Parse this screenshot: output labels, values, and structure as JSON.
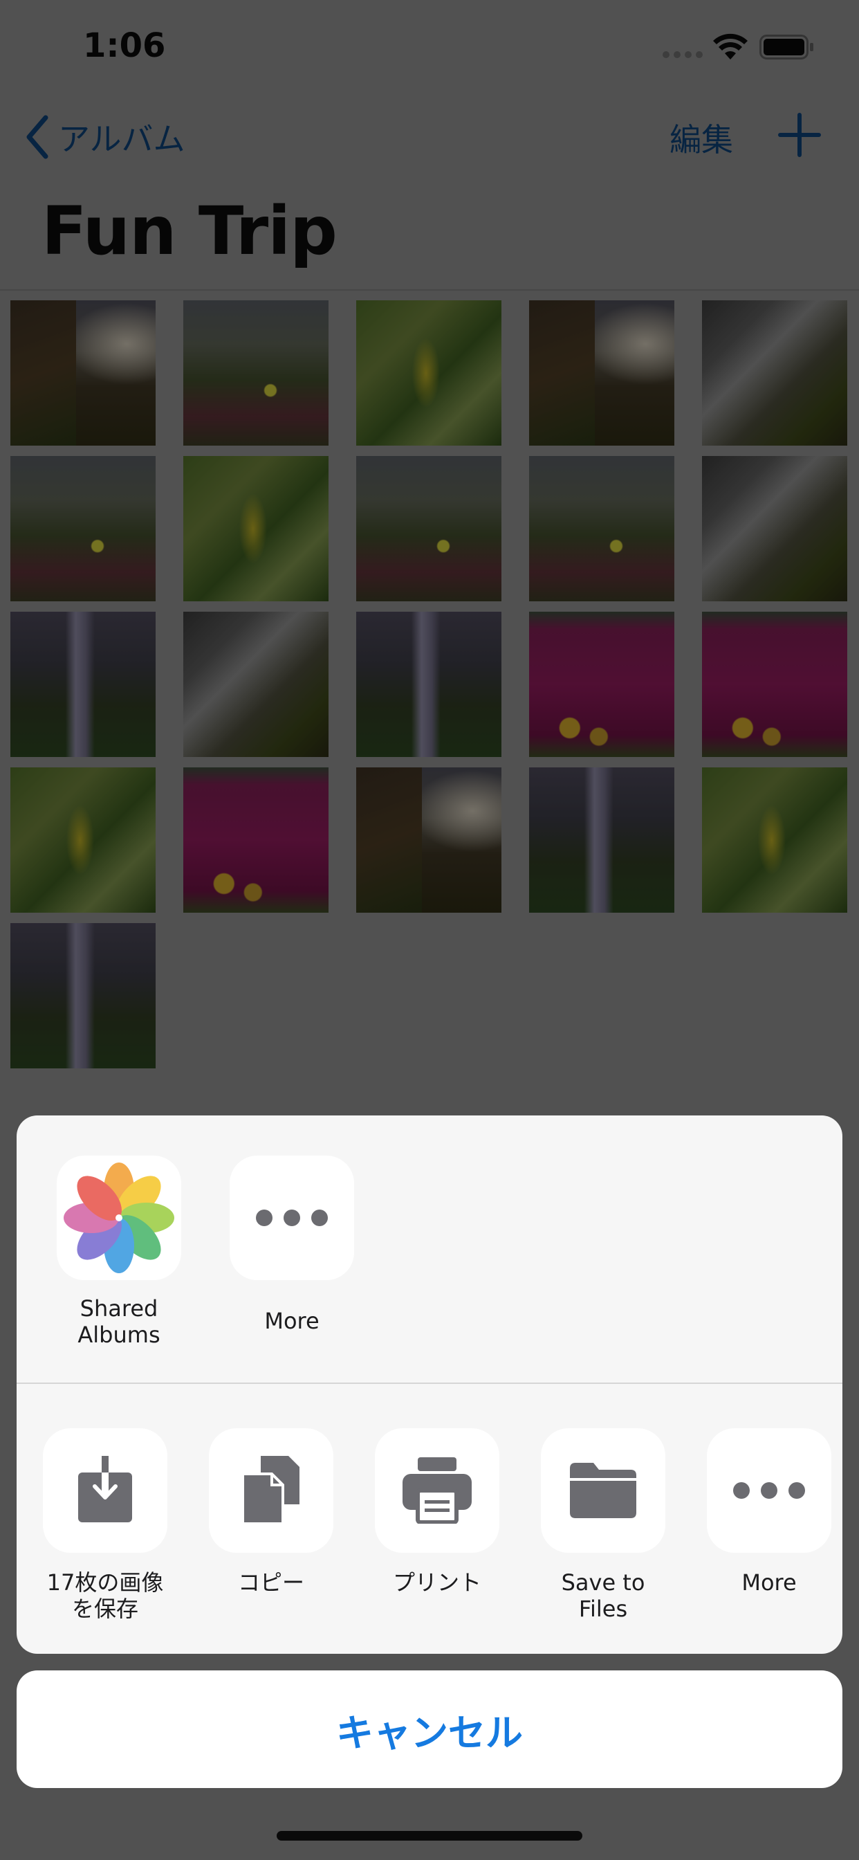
{
  "status_bar": {
    "time": "1:06"
  },
  "nav": {
    "back_label": "アルバム",
    "edit_label": "編集",
    "title": "Fun Trip"
  },
  "photos": [
    "waterfall-cliff",
    "grass-flower",
    "leaves",
    "waterfall-cliff",
    "rapids",
    "grass-flower",
    "leaves",
    "grass-flower",
    "grass-flower",
    "rapids",
    "tall-fall",
    "rapids",
    "tall-fall",
    "pink",
    "pink",
    "leaves",
    "pink",
    "waterfall-cliff",
    "tall-fall",
    "leaves",
    "tall-fall"
  ],
  "share_sheet": {
    "apps": [
      {
        "label": "Shared\nAlbums",
        "icon": "photos-icon"
      },
      {
        "label": "More",
        "icon": "more-icon"
      }
    ],
    "actions": [
      {
        "label": "17枚の画像\nを保存",
        "icon": "save-image-icon"
      },
      {
        "label": "コピー",
        "icon": "copy-icon"
      },
      {
        "label": "プリント",
        "icon": "print-icon"
      },
      {
        "label": "Save to Files",
        "icon": "folder-icon"
      },
      {
        "label": "More",
        "icon": "more-icon"
      }
    ]
  },
  "cancel_label": "キャンセル",
  "colors": {
    "accent": "#157ae0",
    "nav_tint": "#0d3f73",
    "sheet_bg": "#f6f6f6"
  }
}
